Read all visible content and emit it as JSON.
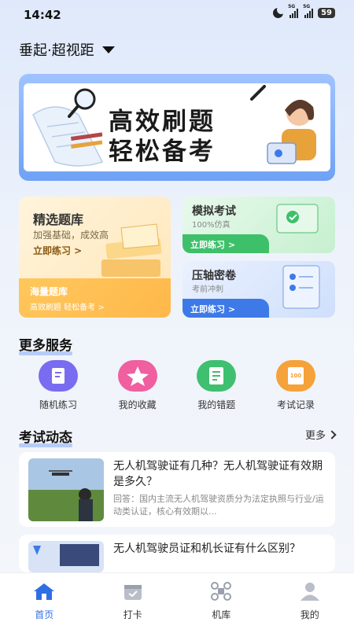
{
  "status_bar": {
    "time": "14:42",
    "network_1": "5G",
    "network_2": "5G",
    "battery": "59"
  },
  "header": {
    "mode": "垂起·超视距"
  },
  "banner": {
    "line1": "高效刷题",
    "line2": "轻松备考"
  },
  "featured": {
    "title": "精选题库",
    "subtitle": "加强基础，成效高",
    "cta": "立即练习 >",
    "bank_title": "海量题库",
    "bank_sub": "高效刷题 轻松备考 >"
  },
  "mock_exam": {
    "title": "模拟考试",
    "subtitle": "100%仿真",
    "cta": "立即练习 >"
  },
  "final_paper": {
    "title": "压轴密卷",
    "subtitle": "考前冲刺",
    "cta": "立即练习 >"
  },
  "services": {
    "title": "更多服务",
    "items": [
      {
        "label": "随机练习",
        "icon": "pencil-doc-icon",
        "color": "#7a6cf0"
      },
      {
        "label": "我的收藏",
        "icon": "star-icon",
        "color": "#f05fa0"
      },
      {
        "label": "我的错题",
        "icon": "notebook-icon",
        "color": "#3fbf70"
      },
      {
        "label": "考试记录",
        "icon": "score-sheet-icon",
        "color": "#f5a23a"
      }
    ]
  },
  "news": {
    "title": "考试动态",
    "more": "更多",
    "items": [
      {
        "title": "无人机驾驶证有几种？无人机驾驶证有效期是多久？",
        "excerpt": "回答：国内主流无人机驾驶资质分为法定执照与行业/运动类认证，核心有效期以..."
      },
      {
        "title": "无人机驾驶员证和机长证有什么区别？",
        "excerpt": ""
      }
    ]
  },
  "tabbar": {
    "items": [
      {
        "label": "首页",
        "active": true
      },
      {
        "label": "打卡",
        "active": false
      },
      {
        "label": "机库",
        "active": false
      },
      {
        "label": "我的",
        "active": false
      }
    ]
  },
  "colors": {
    "accent": "#2f6fe4",
    "mock": "#3ec06a",
    "final": "#3d7ae8",
    "featured": "#ffb84a"
  }
}
